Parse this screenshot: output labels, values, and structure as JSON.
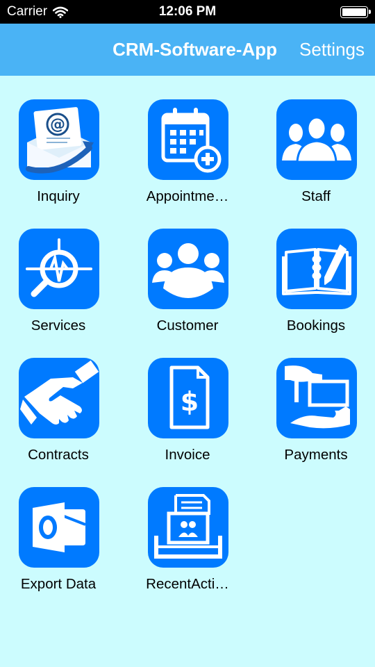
{
  "status_bar": {
    "carrier": "Carrier",
    "time": "12:06 PM",
    "wifi_icon": "wifi-icon",
    "battery_icon": "battery-icon"
  },
  "nav": {
    "title": "CRM-Software-App",
    "settings_label": "Settings"
  },
  "colors": {
    "background": "#ccfcfe",
    "nav_bar": "#4ab3f5",
    "tile": "#007aff"
  },
  "tiles": [
    {
      "label": "Inquiry",
      "icon": "email-envelope-icon"
    },
    {
      "label": "Appointme…",
      "icon": "calendar-add-icon"
    },
    {
      "label": "Staff",
      "icon": "group-people-icon"
    },
    {
      "label": "Services",
      "icon": "search-waveform-icon"
    },
    {
      "label": "Customer",
      "icon": "customers-icon"
    },
    {
      "label": "Bookings",
      "icon": "book-pen-icon"
    },
    {
      "label": "Contracts",
      "icon": "handshake-icon"
    },
    {
      "label": "Invoice",
      "icon": "invoice-dollar-icon"
    },
    {
      "label": "Payments",
      "icon": "payment-hand-icon"
    },
    {
      "label": "Export Data",
      "icon": "outlook-icon"
    },
    {
      "label": "RecentActi…",
      "icon": "recent-activity-icon"
    }
  ]
}
